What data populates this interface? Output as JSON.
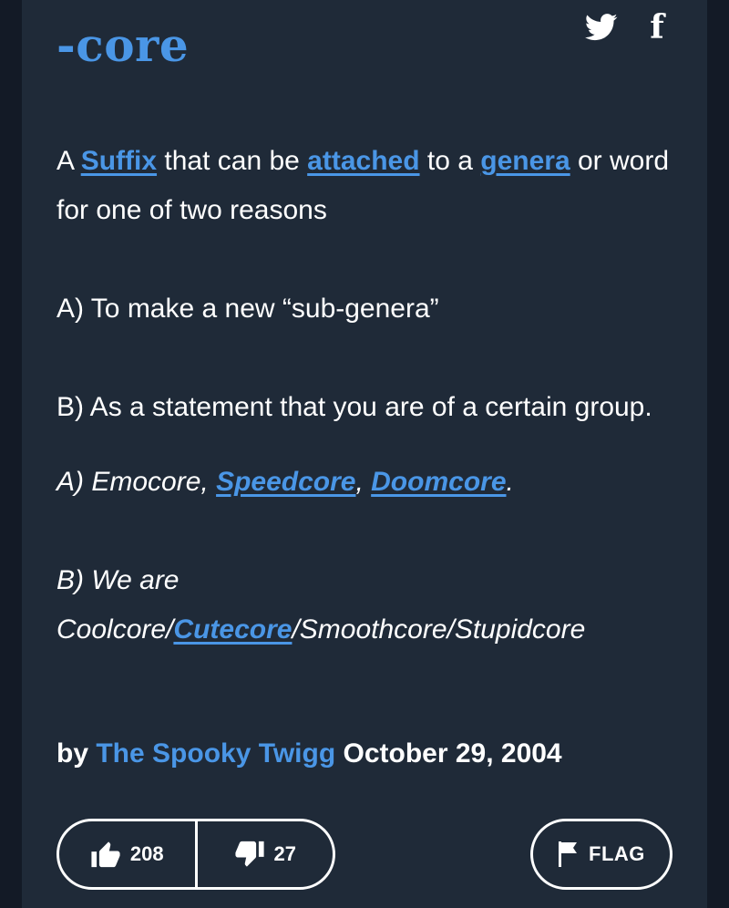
{
  "definition": {
    "word": "-core",
    "paragraphs": [
      [
        {
          "text": "A "
        },
        {
          "text": "Suffix",
          "link": true
        },
        {
          "text": " that can be "
        },
        {
          "text": "attached",
          "link": true
        },
        {
          "text": " to a "
        },
        {
          "text": "genera",
          "link": true
        },
        {
          "text": " or word for one of two reasons"
        }
      ],
      [
        {
          "text": "A) To make a new “sub-genera”"
        }
      ],
      [
        {
          "text": "B) As a statement that you are of a certain group."
        }
      ]
    ],
    "examples": [
      [
        {
          "text": "A) Emocore, "
        },
        {
          "text": "Speedcore",
          "link": true
        },
        {
          "text": ", "
        },
        {
          "text": "Doomcore",
          "link": true
        },
        {
          "text": "."
        }
      ],
      [
        {
          "text": "B) We are Coolcore/"
        },
        {
          "text": "Cutecore",
          "link": true
        },
        {
          "text": "/Smoothcore/Stupidcore"
        }
      ]
    ]
  },
  "byline": {
    "by": "by",
    "author": "The Spooky Twigg",
    "date": "October 29, 2004"
  },
  "share": {
    "icons": [
      "twitter-icon",
      "facebook-icon"
    ]
  },
  "facebook_glyph": "f",
  "votes": {
    "up": "208",
    "down": "27"
  },
  "flag_label": "FLAG",
  "colors": {
    "background": "#131a26",
    "card": "#1f2a38",
    "accent": "#4a96e6",
    "text": "#ffffff"
  }
}
